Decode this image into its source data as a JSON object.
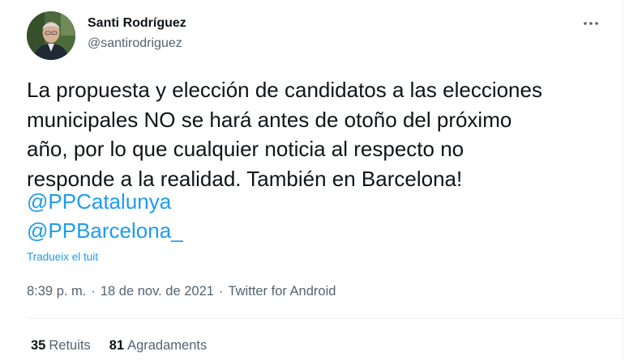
{
  "author": {
    "display_name": "Santi Rodríguez",
    "handle": "@santirodriguez",
    "avatar_icon": "profile-photo"
  },
  "menu": {
    "icon": "more-horizontal-icon"
  },
  "tweet": {
    "lines": [
      "La propuesta y elección de candidatos a las elecciones",
      "municipales NO se hará antes de otoño del próximo",
      "año, por lo que cualquier noticia al respecto no",
      "responde a la realidad. También en Barcelona!"
    ],
    "mentions": [
      "@PPCatalunya",
      "@PPBarcelona_"
    ],
    "translate_label": "Tradueix el tuit"
  },
  "meta": {
    "time": "8:39 p. m.",
    "separator": "·",
    "date": "18 de nov. de 2021",
    "source": "Twitter for Android"
  },
  "stats": {
    "retweets_count": "35",
    "retweets_label": "Retuits",
    "likes_count": "81",
    "likes_label": "Agradaments"
  },
  "colors": {
    "text": "#0f1419",
    "secondary": "#536471",
    "link": "#1d9bf0",
    "divider": "#eff3f4"
  }
}
